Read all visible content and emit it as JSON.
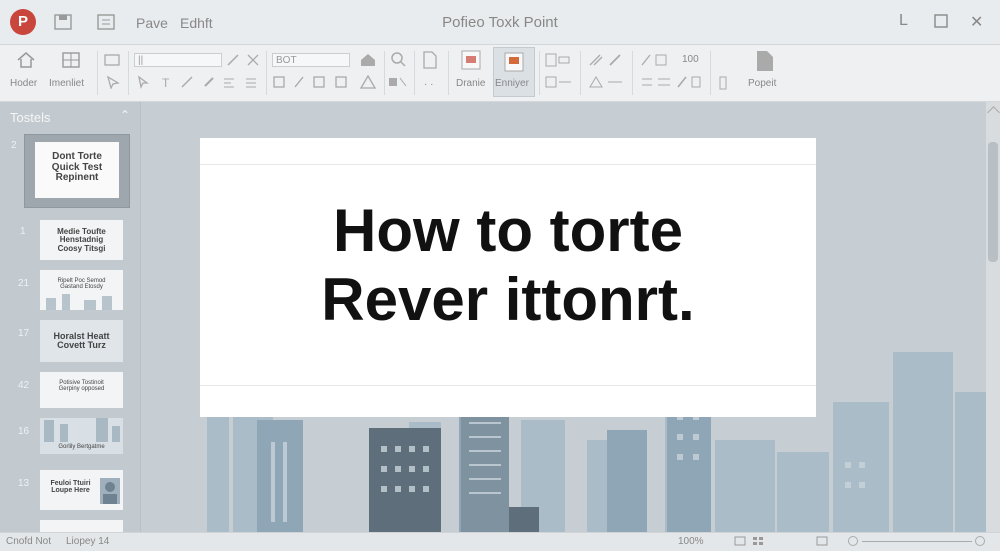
{
  "window": {
    "app_title": "Pofieo Toxk Point",
    "menu": [
      "Pave",
      "Edhft"
    ]
  },
  "ribbon": {
    "buttons": [
      {
        "icon": "home-icon",
        "label": "Hoder"
      },
      {
        "icon": "grid-icon",
        "label": "Imenliet"
      },
      {
        "icon": "new-slide-icon",
        "label": "Dranie"
      },
      {
        "icon": "layout-icon",
        "label": "Enniyer"
      },
      {
        "icon": "document-icon",
        "label": "Popeit"
      }
    ],
    "font_name": "||",
    "font_size": "BOT",
    "zoom_value": "100"
  },
  "slides_panel": {
    "title": "Tostels",
    "thumbs": [
      {
        "num": "2",
        "text": "Dont Torte\nQuick Test\nRepinent"
      },
      {
        "num": "1",
        "text": "Medie Toufte\nHenstadnig\nCoosy Titsgi"
      },
      {
        "num": "21",
        "text": "Ripelt Poc Semod\nGastand Etosdy"
      },
      {
        "num": "17",
        "text": "Horalst Heatt\nCovett Turz"
      },
      {
        "num": "42",
        "text": "Potisive Tostinoit\nGerpiny opposed"
      },
      {
        "num": "16",
        "text": "Gorlily Bertgatme"
      },
      {
        "num": "13",
        "text": "Feuloi Ttuiri\nLoupe Here"
      }
    ]
  },
  "slide": {
    "title_line1": "How to torte",
    "title_line2": "Rever ittonrt."
  },
  "status": {
    "left": "Cnofd Not",
    "slide_info": "Liopey 14",
    "zoom": "100%"
  },
  "colors": {
    "accent": "#c9463d",
    "sky": "#c7ced3",
    "building": "#8ea6b5"
  }
}
